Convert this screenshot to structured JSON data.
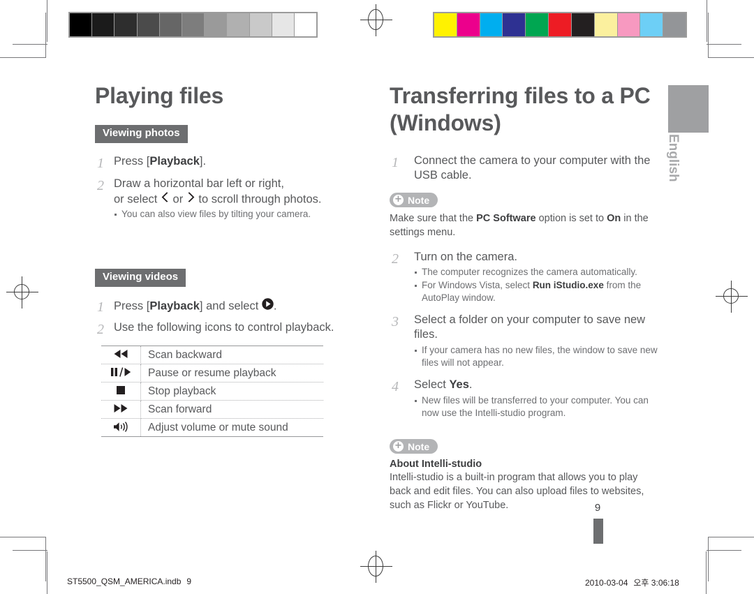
{
  "document": {
    "language_tab": "English",
    "page_number": "9"
  },
  "calibration": {
    "grayscale_swatches": [
      "#000000",
      "#1b1b1b",
      "#2e2e2e",
      "#4b4b4b",
      "#666666",
      "#7d7d7d",
      "#9a9a9a",
      "#b0b0b0",
      "#c9c9c9",
      "#e6e6e6",
      "#ffffff"
    ],
    "color_swatches": [
      "#fff200",
      "#ec008c",
      "#00aeef",
      "#2e3192",
      "#00a651",
      "#ed1c24",
      "#231f20",
      "#fbf09e",
      "#f799c0",
      "#6dcff6",
      "#939598"
    ]
  },
  "left_column": {
    "title": "Playing files",
    "sections": [
      {
        "badge": "Viewing photos",
        "steps": [
          {
            "number": "1",
            "parts": [
              {
                "text": "Press [",
                "bold": false
              },
              {
                "text": "Playback",
                "bold": true
              },
              {
                "text": "].",
                "bold": false
              }
            ],
            "bullets": []
          },
          {
            "number": "2",
            "line1": "Draw a horizontal bar left or right,",
            "line2_pre": "or select ",
            "line2_mid": " or ",
            "line2_post": " to scroll through photos.",
            "icon_left": "chevron-left-icon",
            "icon_right": "chevron-right-icon",
            "bullets": [
              "You can also view files by tilting your camera."
            ]
          }
        ]
      },
      {
        "badge": "Viewing videos",
        "steps": [
          {
            "number": "1",
            "pre": "Press [",
            "bold": "Playback",
            "post": "] and select ",
            "icon": "play-circle-icon",
            "tail": "."
          },
          {
            "number": "2",
            "text": "Use the following icons to control playback."
          }
        ],
        "icon_table": [
          {
            "icon": "rewind-icon",
            "label": "Scan backward"
          },
          {
            "icon": "pause-play-icon",
            "label": "Pause or resume playback"
          },
          {
            "icon": "stop-icon",
            "label": "Stop playback"
          },
          {
            "icon": "fast-forward-icon",
            "label": "Scan forward"
          },
          {
            "icon": "volume-icon",
            "label": "Adjust volume or mute sound"
          }
        ]
      }
    ]
  },
  "right_column": {
    "title_line1": "Transferring files to a PC",
    "title_line2": "(Windows)",
    "steps": [
      {
        "number": "1",
        "text": "Connect the camera to your computer with the USB cable.",
        "bullets": []
      },
      {
        "number": "2",
        "text": "Turn on the camera.",
        "bullets": [
          {
            "pre": "The computer recognizes the camera automatically.",
            "bold": "",
            "post": ""
          },
          {
            "pre": "For Windows Vista, select ",
            "bold": "Run iStudio.exe",
            "post": " from the AutoPlay window."
          }
        ]
      },
      {
        "number": "3",
        "text": "Select a folder on your computer to save new files.",
        "bullets": [
          {
            "pre": "If your camera has no new files, the window to save new files will not appear.",
            "bold": "",
            "post": ""
          }
        ]
      },
      {
        "number": "4",
        "pre": "Select ",
        "bold": "Yes",
        "post": ".",
        "bullets": [
          {
            "pre": "New files will be transferred to your computer. You can now use the Intelli-studio program.",
            "bold": "",
            "post": ""
          }
        ]
      }
    ],
    "note_1": {
      "label": "Note",
      "icon": "plus-circle-icon",
      "body_pre": "Make sure that the ",
      "body_bold_1": "PC Software",
      "body_mid": " option is set to ",
      "body_bold_2": "On",
      "body_post": " in the settings menu."
    },
    "note_2": {
      "label": "Note",
      "icon": "plus-circle-icon",
      "heading": "About Intelli-studio",
      "body": "Intelli-studio is a built-in program that allows you to play back and edit files. You can also upload files to websites, such as Flickr or YouTube."
    }
  },
  "footer": {
    "filename": "ST5500_QSM_AMERICA.indb",
    "page": "9",
    "date": "2010-03-04",
    "time": "오후 3:06:18"
  }
}
